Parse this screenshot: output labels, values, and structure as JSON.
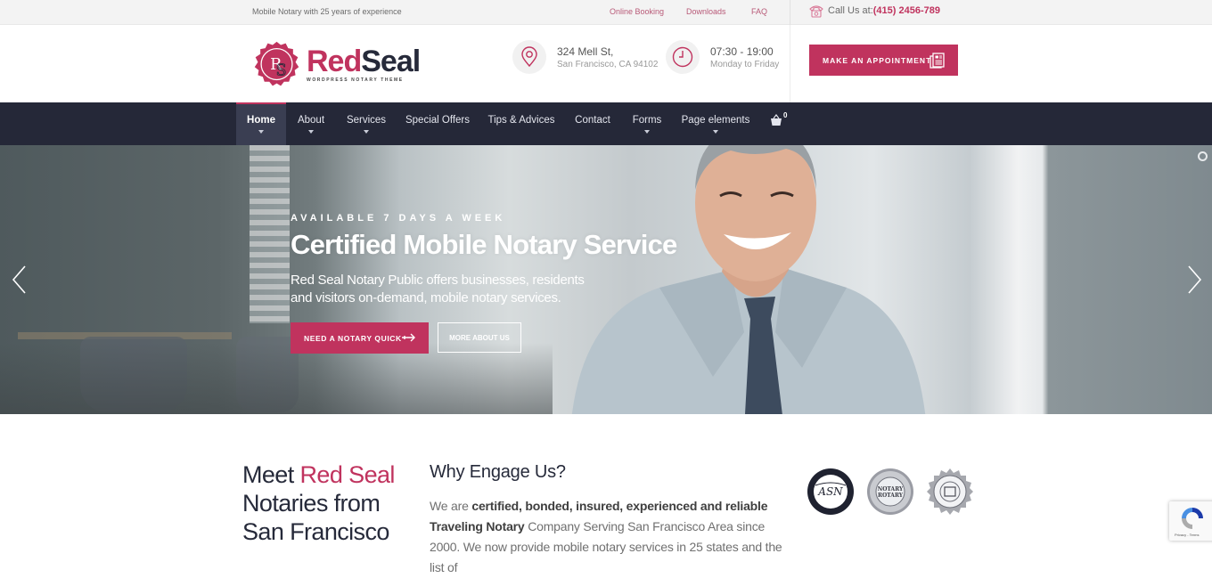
{
  "topbar": {
    "tagline": "Mobile Notary with 25 years of experience",
    "links": [
      "Online Booking",
      "Downloads",
      "FAQ"
    ],
    "call_label": "Call Us at:",
    "call_number": "(415) 2456-789"
  },
  "header": {
    "logo": {
      "initials": "RS",
      "brand_red": "Red",
      "brand_dark": "Seal",
      "subtitle": "WORDPRESS NOTARY THEME"
    },
    "address": {
      "line1": "324 Mell St,",
      "line2": "San Francisco, CA 94102"
    },
    "hours": {
      "line1": "07:30 - 19:00",
      "line2": "Monday to Friday"
    },
    "appointment_button": "MAKE AN APPOINTMENT"
  },
  "nav": {
    "items": [
      {
        "label": "Home",
        "dropdown": true,
        "active": true
      },
      {
        "label": "About",
        "dropdown": true
      },
      {
        "label": "Services",
        "dropdown": true
      },
      {
        "label": "Special Offers",
        "dropdown": false
      },
      {
        "label": "Tips & Advices",
        "dropdown": false
      },
      {
        "label": "Contact",
        "dropdown": false
      },
      {
        "label": "Forms",
        "dropdown": true
      },
      {
        "label": "Page elements",
        "dropdown": true
      }
    ],
    "cart_count": "0"
  },
  "hero": {
    "eyebrow": "AVAILABLE 7 DAYS A WEEK",
    "title": "Certified Mobile Notary Service",
    "description": "Red Seal Notary Public offers businesses, residents and visitors on-demand, mobile notary services.",
    "primary_button": "NEED A NOTARY QUICK",
    "secondary_button": "MORE ABOUT US"
  },
  "about": {
    "heading_prefix": "Meet ",
    "heading_highlight": "Red Seal",
    "heading_suffix": "Notaries from San Francisco",
    "subheading": "Why Engage Us?",
    "body_intro": "We are ",
    "body_bold1": "certified, bonded, insured, experienced and reliable Traveling Notary",
    "body_rest": " Company Serving San Francisco Area since 2000. We now provide mobile notary services in 25 states and the list of",
    "badges": [
      "American Society of Notaries Member",
      "Premier Member Notary Rotary",
      "Certified Background Screened"
    ]
  },
  "recaptcha": {
    "text": "Privacy - Terms"
  },
  "colors": {
    "accent": "#c0335e",
    "nav_bg": "#252838",
    "dark_text": "#262a3a"
  }
}
